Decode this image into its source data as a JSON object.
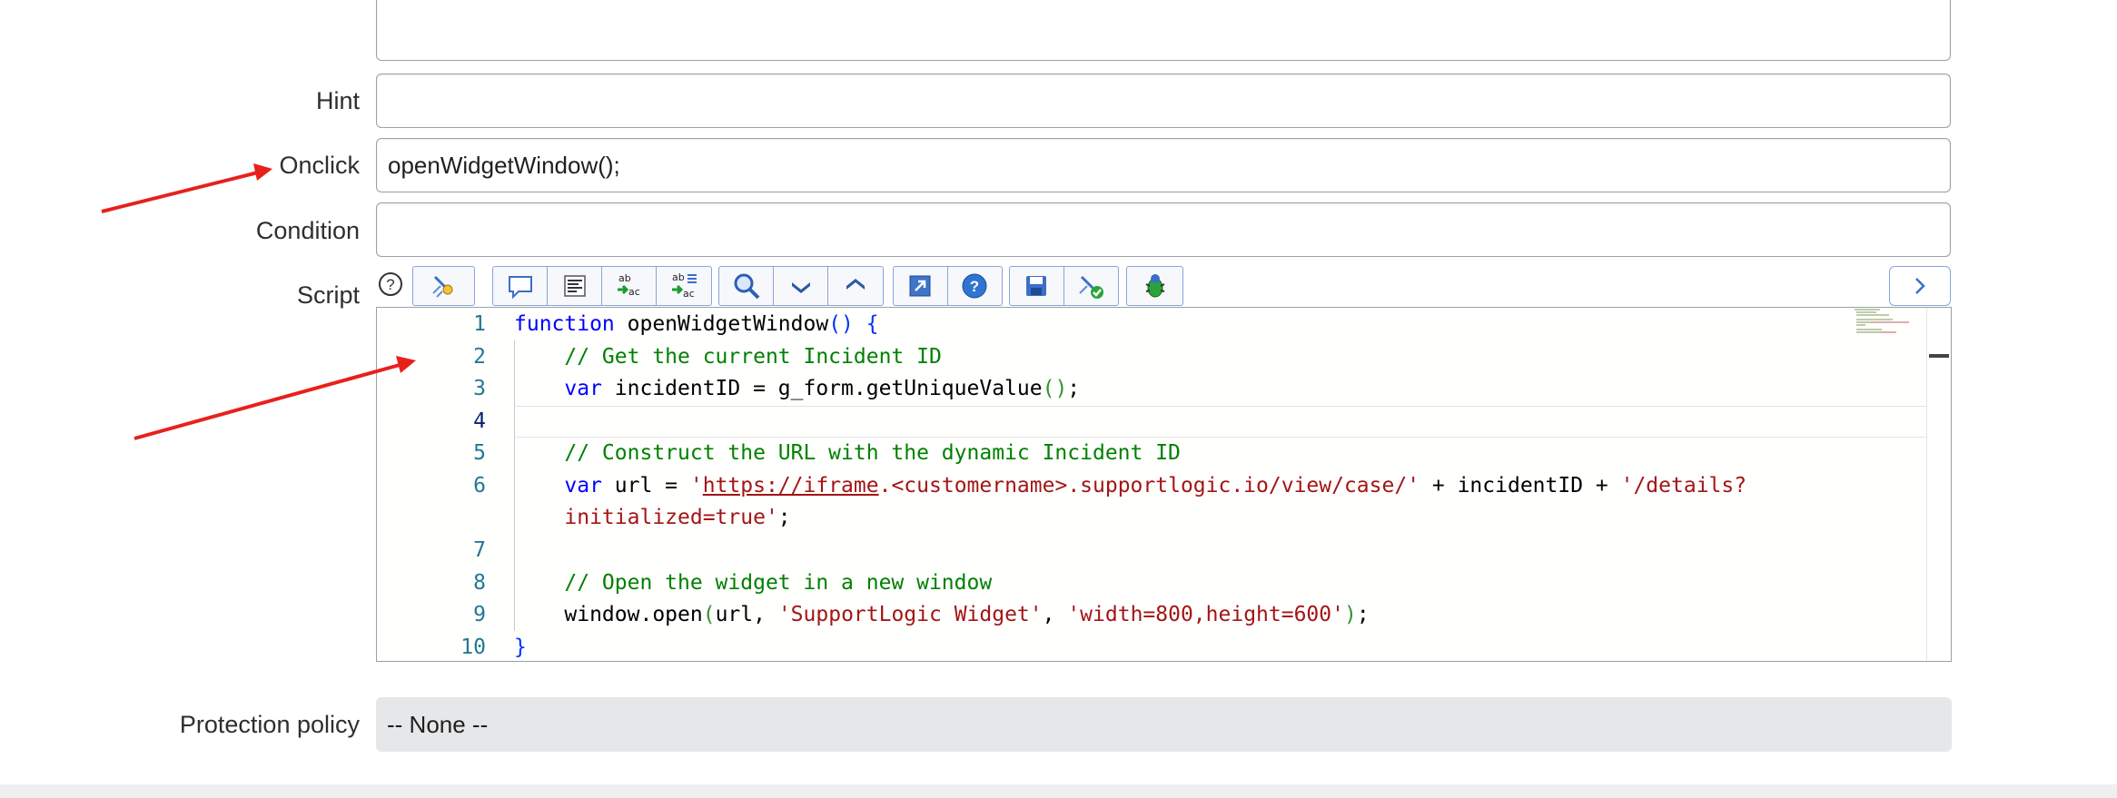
{
  "form": {
    "hint_label": "Hint",
    "hint_value": "",
    "onclick_label": "Onclick",
    "onclick_value": "openWidgetWindow();",
    "condition_label": "Condition",
    "condition_value": "",
    "script_label": "Script",
    "protection_label": "Protection policy",
    "protection_value": "-- None --"
  },
  "toolbar": {
    "help_icon": "question-circle-icon",
    "groups": [
      [
        "script-wizard-icon"
      ],
      [
        "comment-icon",
        "format-icon",
        "replace-icon",
        "replace-all-icon"
      ],
      [
        "search-icon",
        "chevron-down-icon",
        "chevron-up-icon"
      ],
      [
        "fullscreen-icon",
        "help-icon"
      ],
      [
        "save-icon",
        "check-syntax-icon"
      ],
      [
        "debug-icon"
      ]
    ],
    "expand_icon": "chevron-right-icon"
  },
  "editor": {
    "line_numbers": [
      "1",
      "2",
      "3",
      "4",
      "5",
      "6",
      "7",
      "8",
      "9",
      "10"
    ],
    "active_line": "4",
    "code": {
      "l1_kw": "function",
      "l1_name": " openWidgetWindow",
      "l1_paren": "()",
      "l1_brace": " {",
      "l2_comment": "// Get the current Incident ID",
      "l3_kw": "var",
      "l3_rest": " incidentID = g_form.getUniqueValue",
      "l3_paren": "()",
      "l3_end": ";",
      "l5_comment": "// Construct the URL with the dynamic Incident ID",
      "l6_kw": "var",
      "l6_a": " url = ",
      "l6_q1": "'",
      "l6_link": "https://iframe",
      "l6_str1": ".<customername>.supportlogic.io/view/case/'",
      "l6_b": " + incidentID + ",
      "l6_str2": "'/details?",
      "l6w_str": "initialized=true'",
      "l6w_end": ";",
      "l8_comment": "// Open the widget in a new window",
      "l9_a": "window.open",
      "l9_p1": "(",
      "l9_b": "url, ",
      "l9_str1": "'SupportLogic Widget'",
      "l9_c": ", ",
      "l9_str2": "'width=800,height=600'",
      "l9_p2": ")",
      "l9_end": ";",
      "l10_brace": "}"
    }
  },
  "colors": {
    "annotation_arrow": "#e8201c",
    "toolbar_border": "#8aa3d9",
    "keyword": "#0000ff",
    "comment": "#008000",
    "string": "#a31515"
  }
}
